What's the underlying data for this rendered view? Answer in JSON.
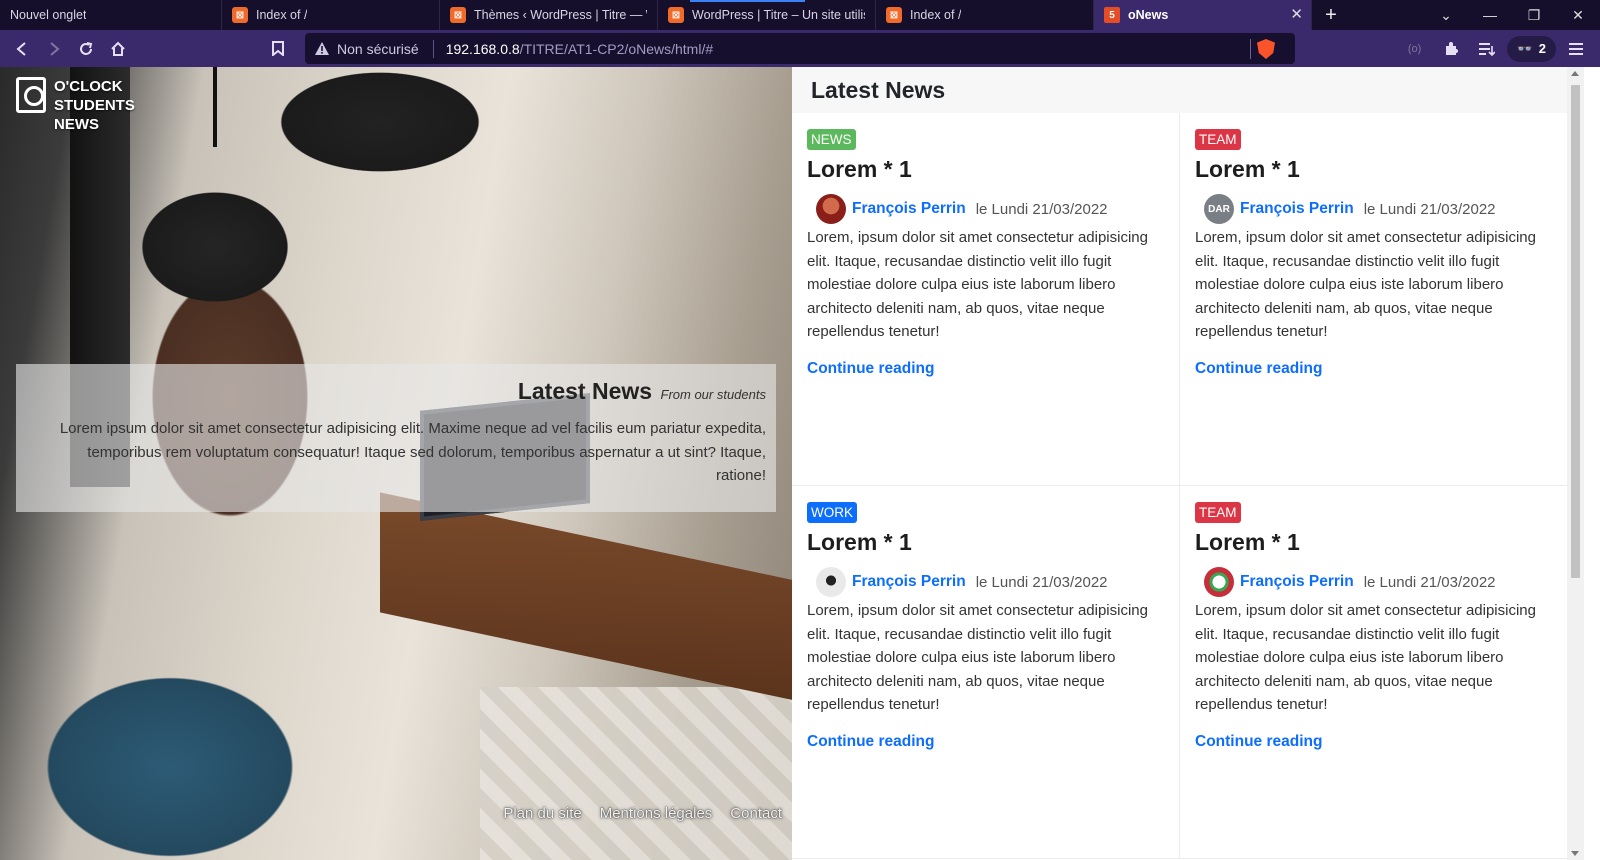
{
  "browser": {
    "tabs": [
      {
        "title": "Nouvel onglet",
        "icon": "none"
      },
      {
        "title": "Index of /",
        "icon": "xampp-icon"
      },
      {
        "title": "Thèmes ‹ WordPress | Titre — Word",
        "icon": "xampp-icon"
      },
      {
        "title": "WordPress | Titre – Un site utilisant",
        "icon": "xampp-icon"
      },
      {
        "title": "Index of /",
        "icon": "xampp-icon"
      },
      {
        "title": "oNews",
        "icon": "html5-icon"
      }
    ],
    "security_label": "Non sécurisé",
    "url_host": "192.168.0.8",
    "url_path": "/TITRE/AT1-CP2/oNews/html/#",
    "shields_count": "2"
  },
  "hero": {
    "brand_lines": [
      "O'CLOCK",
      "STUDENTS",
      "NEWS"
    ],
    "card_title": "Latest News",
    "card_subtitle": "From our students",
    "card_text": "Lorem ipsum dolor sit amet consectetur adipisicing elit. Maxime neque ad vel facilis eum pariatur expedita, temporibus rem voluptatum consequatur! Itaque sed dolorum, temporibus aspernatur a ut sint? Itaque, ratione!",
    "footer_links": [
      "Plan du site",
      "Mentions légales",
      "Contact"
    ]
  },
  "content": {
    "title": "Latest News",
    "articles": [
      {
        "category": "NEWS",
        "category_color": "#5cb85c",
        "title": "Lorem * 1",
        "author": "François Perrin",
        "date": "le Lundi 21/03/2022",
        "avatar_color": "#8a1f1a",
        "avatar_text": "",
        "excerpt": "Lorem, ipsum dolor sit amet consectetur adipisicing elit. Itaque, recusandae distinctio velit illo fugit molestiae dolore culpa eius iste laborum libero architecto deleniti nam, ab quos, vitae neque repellendus tenetur!",
        "link": "Continue reading"
      },
      {
        "category": "TEAM",
        "category_color": "#dc3545",
        "title": "Lorem * 1",
        "author": "François Perrin",
        "date": "le Lundi 21/03/2022",
        "avatar_color": "#7a7f86",
        "avatar_text": "DAR",
        "excerpt": "Lorem, ipsum dolor sit amet consectetur adipisicing elit. Itaque, recusandae distinctio velit illo fugit molestiae dolore culpa eius iste laborum libero architecto deleniti nam, ab quos, vitae neque repellendus tenetur!",
        "link": "Continue reading"
      },
      {
        "category": "WORK",
        "category_color": "#0d6efd",
        "title": "Lorem * 1",
        "author": "François Perrin",
        "date": "le Lundi 21/03/2022",
        "avatar_color": "#e9e9e9",
        "avatar_text": "",
        "excerpt": "Lorem, ipsum dolor sit amet consectetur adipisicing elit. Itaque, recusandae distinctio velit illo fugit molestiae dolore culpa eius iste laborum libero architecto deleniti nam, ab quos, vitae neque repellendus tenetur!",
        "link": "Continue reading"
      },
      {
        "category": "TEAM",
        "category_color": "#dc3545",
        "title": "Lorem * 1",
        "author": "François Perrin",
        "date": "le Lundi 21/03/2022",
        "avatar_color": "#c62f3a",
        "avatar_text": "",
        "excerpt": "Lorem, ipsum dolor sit amet consectetur adipisicing elit. Itaque, recusandae distinctio velit illo fugit molestiae dolore culpa eius iste laborum libero architecto deleniti nam, ab quos, vitae neque repellendus tenetur!",
        "link": "Continue reading"
      }
    ]
  }
}
